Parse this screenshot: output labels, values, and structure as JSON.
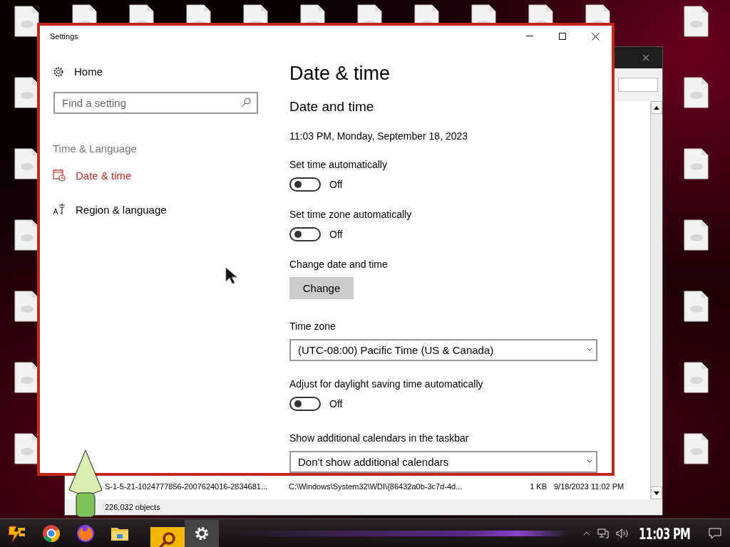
{
  "desktop": {
    "top_icons": [
      {
        "kind": "file"
      },
      {
        "kind": "file"
      },
      {
        "kind": "file"
      },
      {
        "kind": "file"
      },
      {
        "kind": "file"
      },
      {
        "kind": "file"
      },
      {
        "kind": "file"
      },
      {
        "kind": "file"
      },
      {
        "kind": "file"
      },
      {
        "kind": "file"
      }
    ],
    "left_icons": [
      {
        "kind": "file"
      },
      {
        "kind": "file"
      },
      {
        "kind": "file"
      },
      {
        "kind": "file"
      },
      {
        "kind": "file"
      },
      {
        "kind": "file"
      },
      {
        "kind": "file"
      }
    ],
    "right_icons": [
      {
        "kind": "file"
      },
      {
        "kind": "file"
      },
      {
        "kind": "file"
      },
      {
        "kind": "file"
      },
      {
        "kind": "file"
      },
      {
        "kind": "file"
      },
      {
        "kind": "file"
      }
    ]
  },
  "explorer": {
    "row": {
      "name": "S-1-5-21-1024777856-2007624016-2834681...",
      "path": "C:\\Windows\\System32\\WDI\\{86432a0b-3c7d-4d...",
      "size": "1 KB",
      "date": "9/18/2023 11:02 PM"
    },
    "status": "226,032 objects"
  },
  "settings": {
    "title": "Settings",
    "sidebar": {
      "home": "Home",
      "search": {
        "placeholder": "Find a setting"
      },
      "section": "Time & Language",
      "items": [
        {
          "label": "Date & time",
          "kind": "calendar",
          "selected": true
        },
        {
          "label": "Region & language",
          "kind": "language",
          "selected": false
        }
      ]
    },
    "content": {
      "title": "Date & time",
      "heading": "Date and time",
      "current": "11:03 PM, Monday, September 18, 2023",
      "rows": [
        {
          "kind": "toggle",
          "label": "Set time automatically",
          "on": false,
          "state": "Off"
        },
        {
          "kind": "toggle",
          "label": "Set time zone automatically",
          "on": false,
          "state": "Off"
        },
        {
          "kind": "button",
          "label": "Change date and time",
          "button": "Change"
        },
        {
          "kind": "dropdown",
          "label": "Time zone",
          "value": "(UTC-08:00) Pacific Time (US & Canada)"
        },
        {
          "kind": "toggle",
          "label": "Adjust for daylight saving time automatically",
          "on": false,
          "state": "Off"
        },
        {
          "kind": "dropdown",
          "label": "Show additional calendars in the taskbar",
          "value": "Don't show additional calendars"
        }
      ]
    }
  },
  "taskbar": {
    "apps": [
      {
        "kind": "launcher",
        "selected": false
      },
      {
        "kind": "browser",
        "selected": false
      },
      {
        "kind": "fox",
        "selected": false
      },
      {
        "kind": "folder",
        "selected": false
      },
      {
        "kind": "search",
        "selected": false
      },
      {
        "kind": "gear",
        "selected": true
      }
    ],
    "clock": "11:03 PM"
  }
}
